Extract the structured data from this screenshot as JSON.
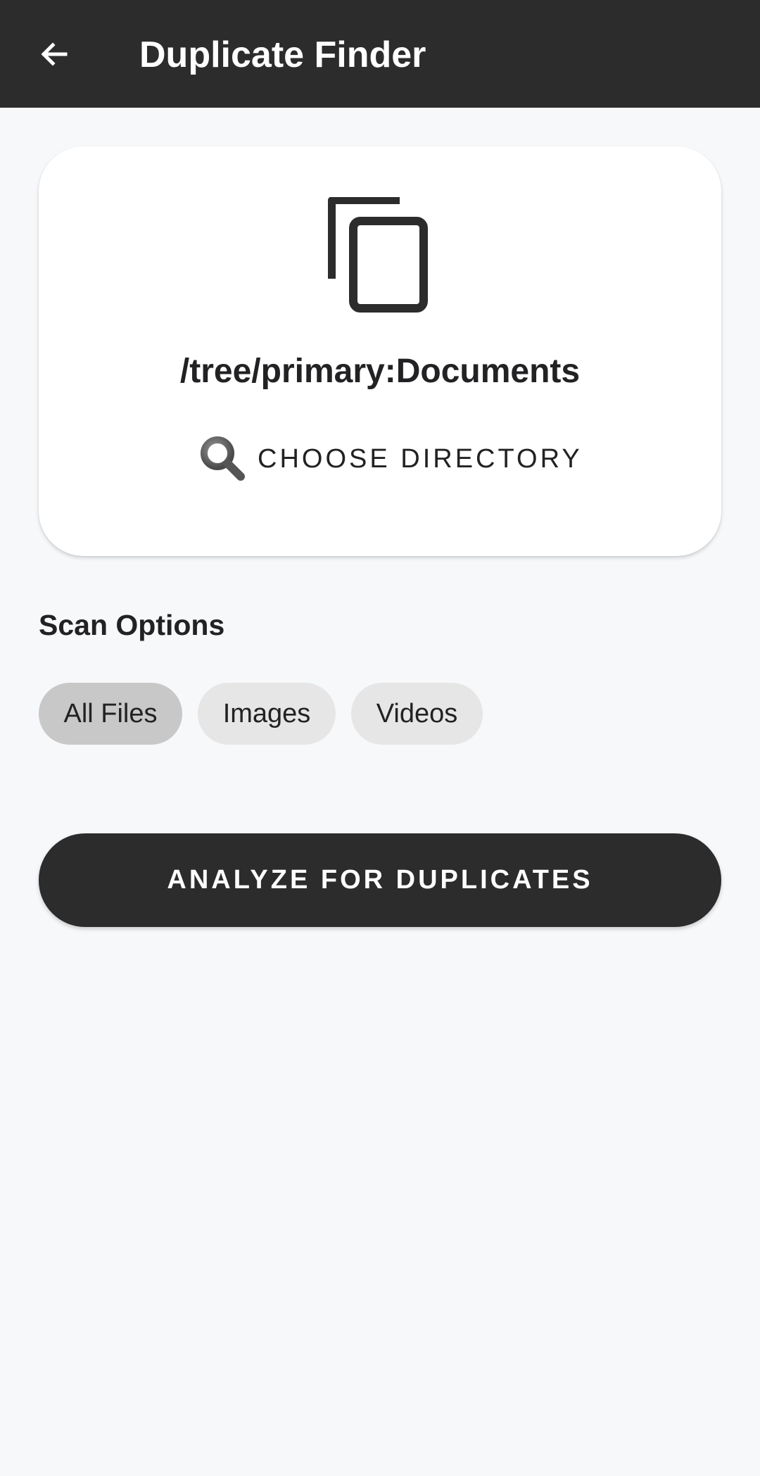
{
  "app_bar": {
    "title": "Duplicate Finder",
    "back_icon": "arrow-left-icon",
    "background_color": "#2c2c2d"
  },
  "directory_card": {
    "icon": "copy-icon",
    "path": "/tree/primary:Documents",
    "choose_button_icon": "search-icon",
    "choose_button_label": "CHOOSE DIRECTORY"
  },
  "scan_options": {
    "title": "Scan Options",
    "chips": [
      {
        "label": "All Files",
        "selected": true
      },
      {
        "label": "Images",
        "selected": false
      },
      {
        "label": "Videos",
        "selected": false
      }
    ]
  },
  "analyze_button": {
    "label": "ANALYZE FOR DUPLICATES"
  }
}
